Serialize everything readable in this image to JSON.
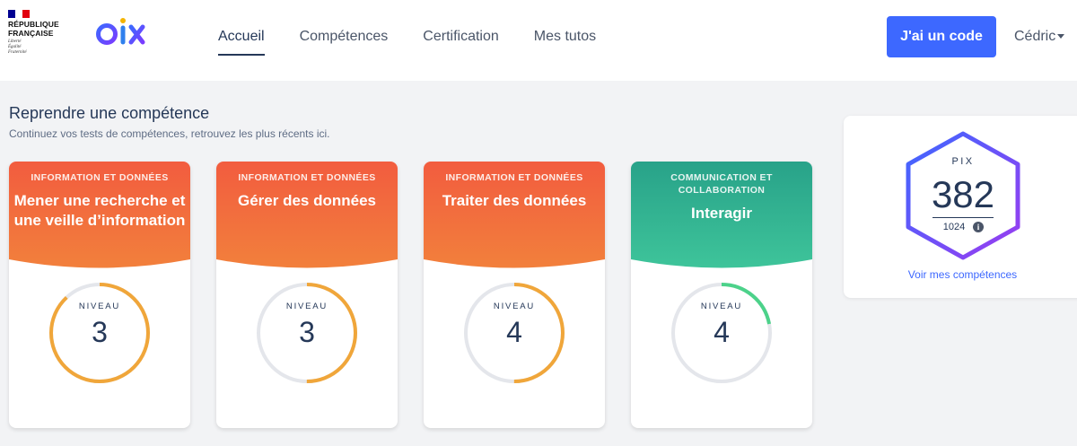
{
  "header": {
    "gov_name_line1": "RÉPUBLIQUE",
    "gov_name_line2": "FRANÇAISE",
    "gov_motto_1": "Liberté",
    "gov_motto_2": "Égalité",
    "gov_motto_3": "Fraternité",
    "brand": "pix",
    "nav": [
      {
        "label": "Accueil",
        "active": true
      },
      {
        "label": "Compétences",
        "active": false
      },
      {
        "label": "Certification",
        "active": false
      },
      {
        "label": "Mes tutos",
        "active": false
      }
    ],
    "cta_label": "J'ai un code",
    "user_name": "Cédric"
  },
  "section": {
    "title": "Reprendre une compétence",
    "subtitle": "Continuez vos tests de compétences, retrouvez les plus récents ici."
  },
  "cards": [
    {
      "area": "INFORMATION ET DONNÉES",
      "title": "Mener une recherche et une veille d’information",
      "level_label": "NIVEAU",
      "level": "3",
      "progress": 0.88,
      "color_top": "#f25c3f",
      "color_bottom": "#f2803c",
      "gauge_color": "#f0a63a"
    },
    {
      "area": "INFORMATION ET DONNÉES",
      "title": "Gérer des données",
      "level_label": "NIVEAU",
      "level": "3",
      "progress": 0.5,
      "color_top": "#f25c3f",
      "color_bottom": "#f2803c",
      "gauge_color": "#f0a63a"
    },
    {
      "area": "INFORMATION ET DONNÉES",
      "title": "Traiter des données",
      "level_label": "NIVEAU",
      "level": "4",
      "progress": 0.5,
      "color_top": "#f25c3f",
      "color_bottom": "#f2803c",
      "gauge_color": "#f0a63a"
    },
    {
      "area": "COMMUNICATION ET COLLABORATION",
      "title": "Interagir",
      "level_label": "NIVEAU",
      "level": "4",
      "progress": 0.22,
      "color_top": "#28a289",
      "color_bottom": "#3ec49a",
      "gauge_color": "#4cd28a"
    }
  ],
  "score": {
    "label": "PIX",
    "value": "382",
    "max": "1024",
    "info_icon": "info-icon",
    "link": "Voir mes compétences"
  }
}
